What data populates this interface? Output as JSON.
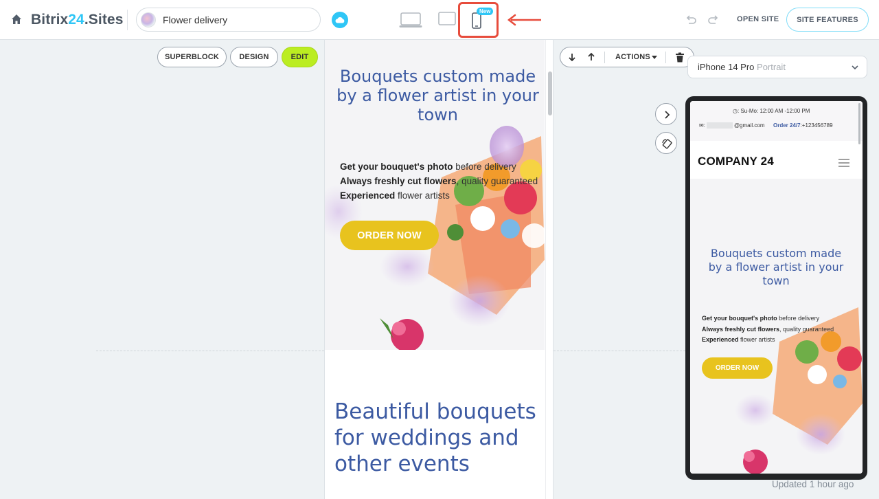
{
  "header": {
    "brand_prefix": "Bitrix",
    "brand_accent": "24",
    "brand_suffix": ".Sites",
    "site_name": "Flower delivery",
    "new_badge": "New",
    "open_site": "OPEN SITE",
    "site_features": "SITE FEATURES"
  },
  "block_toolbar": {
    "superblock": "SUPERBLOCK",
    "design": "DESIGN",
    "edit": "EDIT",
    "actions": "ACTIONS"
  },
  "editor_page": {
    "hero_title": "Bouquets custom made by a flower artist in your town",
    "line1_bold": "Get your bouquet's photo",
    "line1_rest": " before delivery",
    "line2_bold": "Always freshly cut flowers",
    "line2_rest": ", quality guaranteed",
    "line3_bold": "Experienced",
    "line3_rest": " flower artists",
    "order_button": "ORDER NOW",
    "section_title": "Beautiful bouquets for weddings and other events"
  },
  "preview": {
    "device_name": "iPhone 14 Pro",
    "orientation": "Portrait",
    "hours": "Su-Mo: 12:00 AM -12:00 PM",
    "email_suffix": "@gmail.com",
    "order_label": "Order 24/7",
    "phone": ":+123456789",
    "company": "COMPANY 24",
    "hero_title": "Bouquets custom made by a flower artist in your town",
    "line1_bold": "Get your bouquet's photo",
    "line1_rest": " before delivery",
    "line2_bold": "Always freshly cut flowers",
    "line2_rest": ", quality guaranteed",
    "line3_bold": "Experienced",
    "line3_rest": " flower artists",
    "order_button": "ORDER NOW"
  },
  "status": {
    "updated": "Updated 1 hour ago"
  },
  "colors": {
    "accent": "#2fc6f6",
    "edit_green": "#bbed21",
    "title_blue": "#3c5aa2",
    "order_yellow": "#e8c31e",
    "highlight_red": "#e74c3c"
  },
  "icons": [
    "home-icon",
    "cloud-icon",
    "desktop-icon",
    "tablet-icon",
    "mobile-icon",
    "arrow-left-icon",
    "undo-icon",
    "redo-icon",
    "arrow-down-icon",
    "arrow-up-icon",
    "caret-down-icon",
    "trash-icon",
    "chevron-down-icon",
    "chevron-right-icon",
    "rotate-icon",
    "burger-menu-icon"
  ]
}
